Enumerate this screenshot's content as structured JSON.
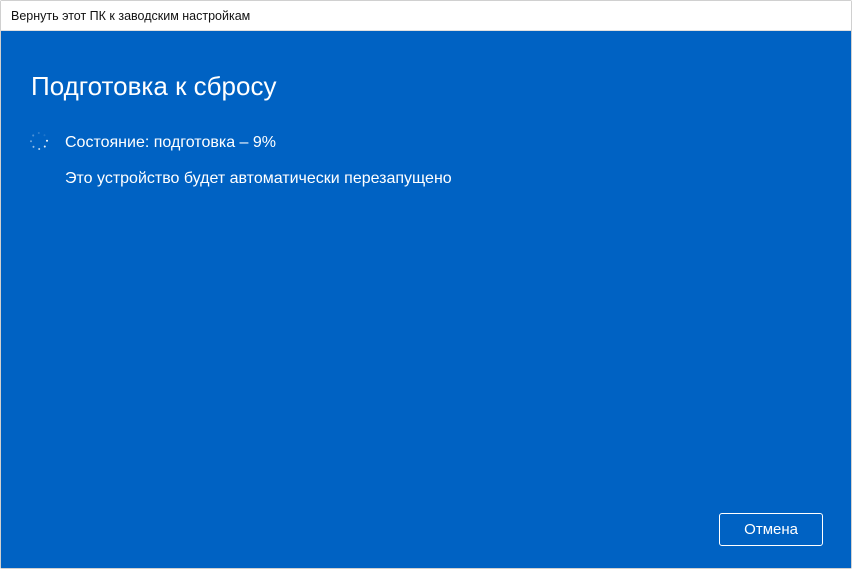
{
  "titlebar": {
    "title": "Вернуть этот ПК к заводским настройкам"
  },
  "main": {
    "heading": "Подготовка к сбросу",
    "status_text": "Состояние: подготовка – 9%",
    "sub_text": "Это устройство будет автоматически перезапущено"
  },
  "footer": {
    "cancel_label": "Отмена"
  },
  "colors": {
    "primary": "#0062c3",
    "text_on_primary": "#ffffff",
    "titlebar_bg": "#ffffff",
    "titlebar_text": "#111111"
  }
}
